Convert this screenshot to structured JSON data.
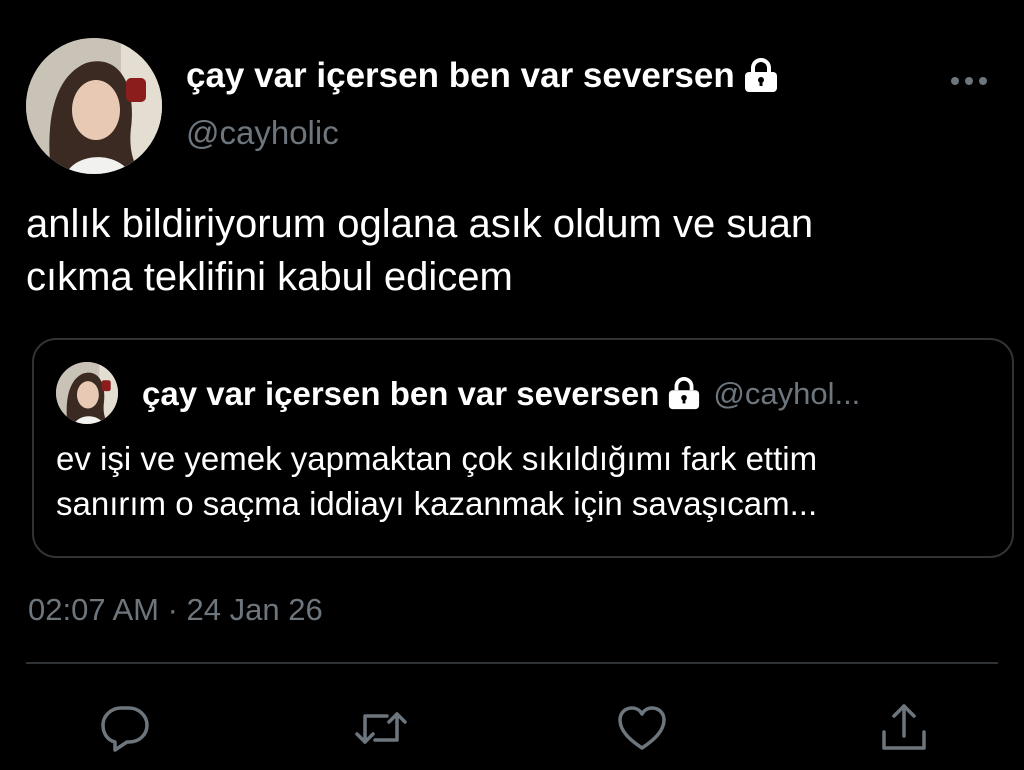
{
  "author": {
    "display_name": "çay var içersen ben var seversen",
    "handle": "@cayholic",
    "avatar_icon": "profile-photo",
    "lock_icon": "lock-icon"
  },
  "tweet": {
    "text_lines": [
      "anlık bildiriyorum oglana asık oldum ve suan",
      "cıkma teklifini kabul edicem"
    ],
    "timestamp": "02:07 AM · 24 Jan 26"
  },
  "quoted_tweet": {
    "display_name": "çay var içersen ben var seversen",
    "handle": "@cayhol...",
    "text_lines": [
      "ev işi ve yemek yapmaktan çok sıkıldığımı fark ettim",
      "sanırım o saçma iddiayı kazanmak için savaşıcam..."
    ]
  },
  "actions": [
    "reply-icon",
    "retweet-icon",
    "like-icon",
    "share-icon"
  ],
  "colors": {
    "background": "#000000",
    "text": "#ffffff",
    "secondary_text": "#6e767d",
    "border": "#2f3336"
  }
}
